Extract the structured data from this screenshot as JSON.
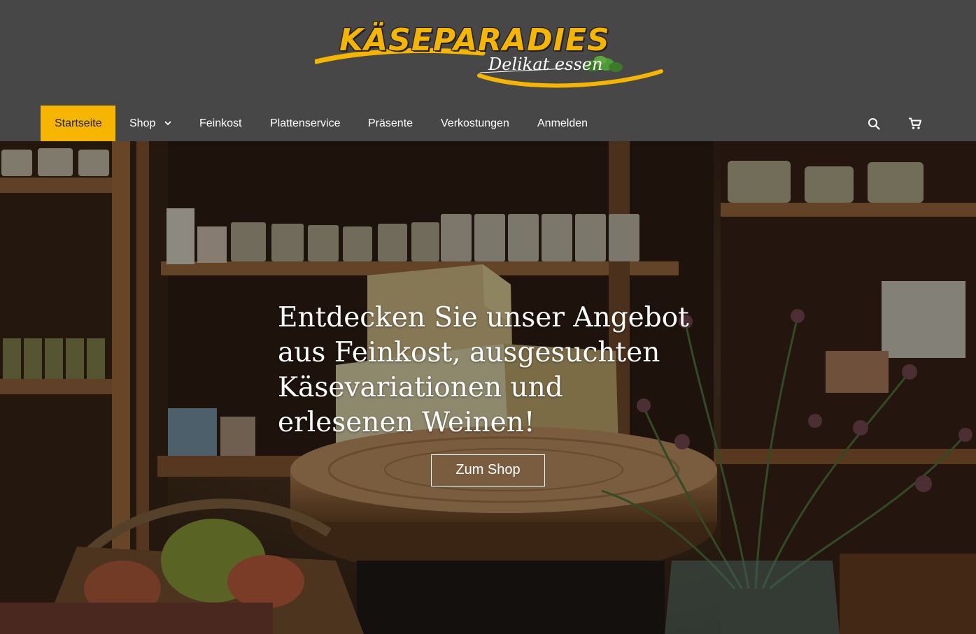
{
  "logo": {
    "wordmark": "KÄSEPARADIES",
    "tagline": "Delikat essen"
  },
  "nav": {
    "items": [
      {
        "label": "Startseite",
        "active": true
      },
      {
        "label": "Shop",
        "has_dropdown": true
      },
      {
        "label": "Feinkost"
      },
      {
        "label": "Plattenservice"
      },
      {
        "label": "Präsente"
      },
      {
        "label": "Verkostungen"
      },
      {
        "label": "Anmelden"
      }
    ],
    "icons": [
      "search-icon",
      "cart-icon"
    ]
  },
  "hero": {
    "headline": "Entdecken Sie unser Angebot aus Feinkost, ausgesuchten Käsevariationen und erlesenen Weinen!",
    "button_label": "Zum Shop"
  },
  "colors": {
    "header_bg": "#474747",
    "accent": "#f6b500",
    "text_light": "#ffffff"
  }
}
